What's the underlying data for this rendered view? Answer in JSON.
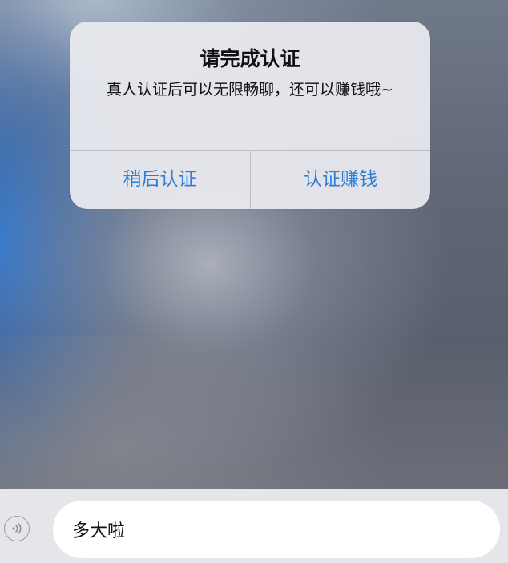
{
  "dialog": {
    "title": "请完成认证",
    "message": "真人认证后可以无限畅聊，还可以赚钱哦~",
    "buttons": {
      "later": "稍后认证",
      "verify": "认证赚钱"
    },
    "accent_color": "#2f7ed8"
  },
  "input_bar": {
    "voice_icon": "voice-icon",
    "text_value": "多大啦"
  }
}
